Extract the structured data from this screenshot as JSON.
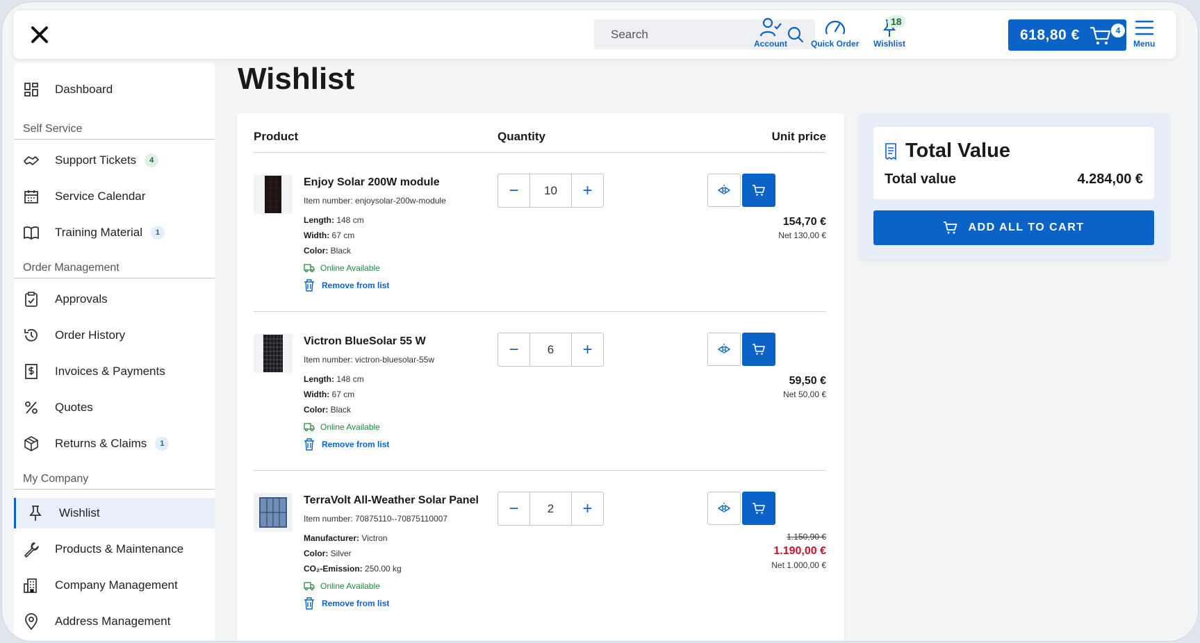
{
  "header": {
    "search_placeholder": "Search",
    "account_label": "Account",
    "quick_order_label": "Quick Order",
    "wishlist_label": "Wishlist",
    "wishlist_count": "18",
    "cart_amount": "618,80 €",
    "cart_count": "4",
    "menu_label": "Menu"
  },
  "sidebar": {
    "dashboard": "Dashboard",
    "section_self_service": "Self Service",
    "support_tickets": "Support Tickets",
    "support_tickets_badge": "4",
    "service_calendar": "Service Calendar",
    "training_material": "Training Material",
    "training_material_badge": "1",
    "section_order_management": "Order Management",
    "approvals": "Approvals",
    "order_history": "Order History",
    "invoices_payments": "Invoices & Payments",
    "quotes": "Quotes",
    "returns_claims": "Returns & Claims",
    "returns_claims_badge": "1",
    "section_my_company": "My Company",
    "wishlist": "Wishlist",
    "products_maintenance": "Products & Maintenance",
    "company_management": "Company Management",
    "address_management": "Address Management"
  },
  "page": {
    "title": "Wishlist"
  },
  "table": {
    "col_product": "Product",
    "col_quantity": "Quantity",
    "col_unit_price": "Unit price"
  },
  "items": [
    {
      "name": "Enjoy Solar 200W module",
      "item_number": "Item number: enjoysolar-200w-module",
      "attr1_label": "Length:",
      "attr1_value": " 148 cm",
      "attr2_label": "Width:",
      "attr2_value": " 67 cm",
      "attr3_label": "Color:",
      "attr3_value": " Black",
      "availability": "Online Available",
      "remove": "Remove from list",
      "quantity": "10",
      "price": "154,70 €",
      "net": "Net 130,00 €"
    },
    {
      "name": "Victron BlueSolar 55 W",
      "item_number": "Item number: victron-bluesolar-55w",
      "attr1_label": "Length:",
      "attr1_value": " 148 cm",
      "attr2_label": "Width:",
      "attr2_value": " 67 cm",
      "attr3_label": "Color:",
      "attr3_value": " Black",
      "availability": "Online Available",
      "remove": "Remove from list",
      "quantity": "6",
      "price": "59,50 €",
      "net": "Net 50,00 €"
    },
    {
      "name": "TerraVolt All-Weather Solar Panel",
      "item_number": "Item number: 70875110--70875110007",
      "attr1_label": "Manufacturer:",
      "attr1_value": " Victron",
      "attr2_label": "Color:",
      "attr2_value": " Silver",
      "attr3_label": "CO₂-Emission:",
      "attr3_value": " 250.00 kg",
      "availability": "Online Available",
      "remove": "Remove from list",
      "quantity": "2",
      "old_price": "1.150,90 €",
      "price": "1.190,00 €",
      "net": "Net 1.000,00 €"
    }
  ],
  "summary": {
    "title": "Total Value",
    "total_label": "Total value",
    "total_value": "4.284,00 €",
    "add_all": "ADD ALL TO CART"
  },
  "colors": {
    "primary": "#0b63c7",
    "available": "#1d8a3c",
    "sale": "#c8102e"
  }
}
